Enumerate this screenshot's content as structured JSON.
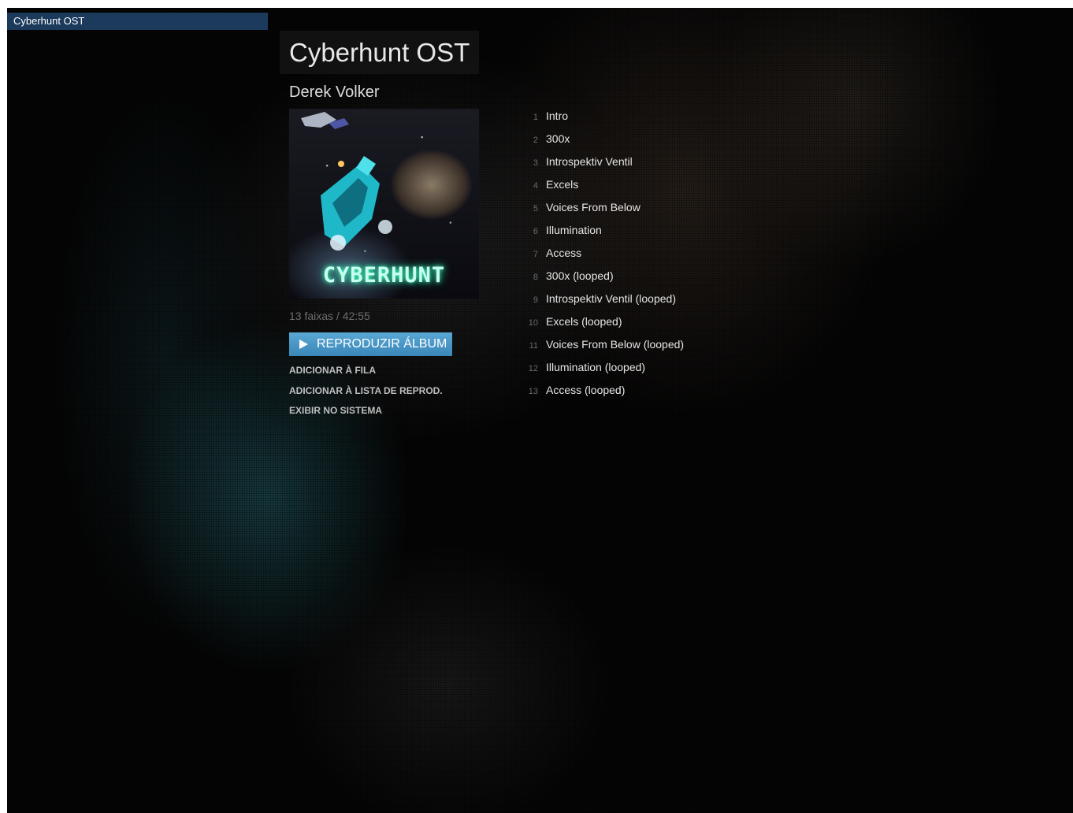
{
  "window": {
    "title": "Cyberhunt OST"
  },
  "album": {
    "title": "Cyberhunt OST",
    "artist": "Derek Volker",
    "cover_logo": "CYBERHUNT",
    "summary": "13 faixas / 42:55"
  },
  "actions": {
    "play_label": "REPRODUZIR ÁLBUM",
    "queue_label": "ADICIONAR À FILA",
    "playlist_label": "ADICIONAR À LISTA DE REPROD.",
    "system_label": "EXIBIR NO SISTEMA"
  },
  "tracks": [
    {
      "num": "1",
      "name": "Intro"
    },
    {
      "num": "2",
      "name": "300x"
    },
    {
      "num": "3",
      "name": "Introspektiv Ventil"
    },
    {
      "num": "4",
      "name": "Excels"
    },
    {
      "num": "5",
      "name": "Voices From Below"
    },
    {
      "num": "6",
      "name": "Illumination"
    },
    {
      "num": "7",
      "name": "Access"
    },
    {
      "num": "8",
      "name": "300x (looped)"
    },
    {
      "num": "9",
      "name": "Introspektiv Ventil (looped)"
    },
    {
      "num": "10",
      "name": "Excels (looped)"
    },
    {
      "num": "11",
      "name": "Voices From Below (looped)"
    },
    {
      "num": "12",
      "name": "Illumination (looped)"
    },
    {
      "num": "13",
      "name": "Access (looped)"
    }
  ],
  "colors": {
    "titlebar": "#1c3a5c",
    "play_button": "#4a98c8",
    "background": "#000000"
  }
}
